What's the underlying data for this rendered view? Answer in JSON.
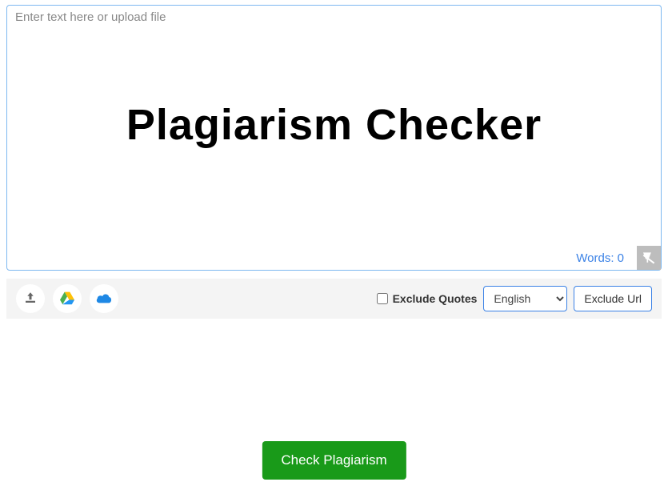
{
  "editor": {
    "placeholder": "Enter text here or upload file",
    "heading": "Plagiarism Checker",
    "word_count_label": "Words: 0"
  },
  "toolbar": {
    "upload_icon": "upload-icon",
    "gdrive_icon": "google-drive-icon",
    "cloud_icon": "cloud-icon",
    "exclude_quotes_label": "Exclude Quotes",
    "language_selected": "English",
    "exclude_url_label": "Exclude Url"
  },
  "actions": {
    "check_label": "Check Plagiarism"
  }
}
